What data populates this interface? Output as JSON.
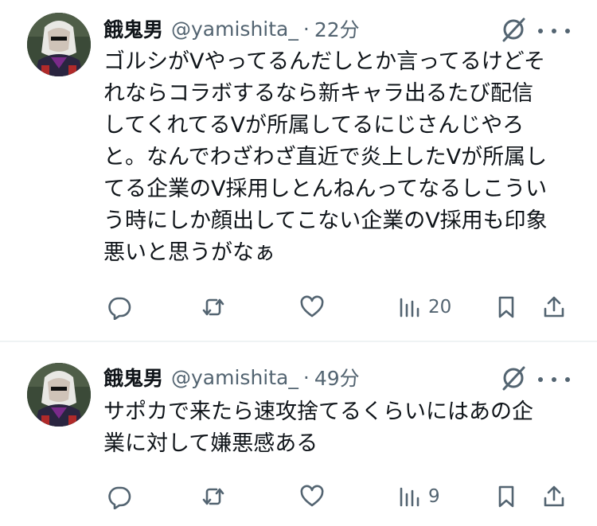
{
  "tweets": [
    {
      "author": {
        "name": "餓鬼男",
        "handle": "@yamishita_"
      },
      "separator": "·",
      "time": "22分",
      "text_lines": [
        "ゴルシがVやってるんだしとか言ってるけどそ",
        "れならコラボするなら新キャラ出るたび配信",
        "してくれてるVが所属してるにじさんじやろ",
        "と。なんでわざわざ直近で炎上したVが所属し",
        "てる企業のV採用しとんねんってなるしこうい",
        "う時にしか顔出してこない企業のV採用も印象",
        "悪いと思うがなぁ"
      ],
      "views": "20"
    },
    {
      "author": {
        "name": "餓鬼男",
        "handle": "@yamishita_"
      },
      "separator": "·",
      "time": "49分",
      "text_lines": [
        "サポカで来たら速攻捨てるくらいにはあの企",
        "業に対して嫌悪感ある"
      ],
      "views": "9"
    }
  ],
  "icons": {
    "grok": "grok-icon",
    "more": "more-icon",
    "reply": "reply-icon",
    "retweet": "retweet-icon",
    "like": "like-icon",
    "views": "views-icon",
    "bookmark": "bookmark-icon",
    "share": "share-icon"
  },
  "colors": {
    "text": "#0f1419",
    "secondary": "#536471",
    "divider": "#eff3f4"
  }
}
